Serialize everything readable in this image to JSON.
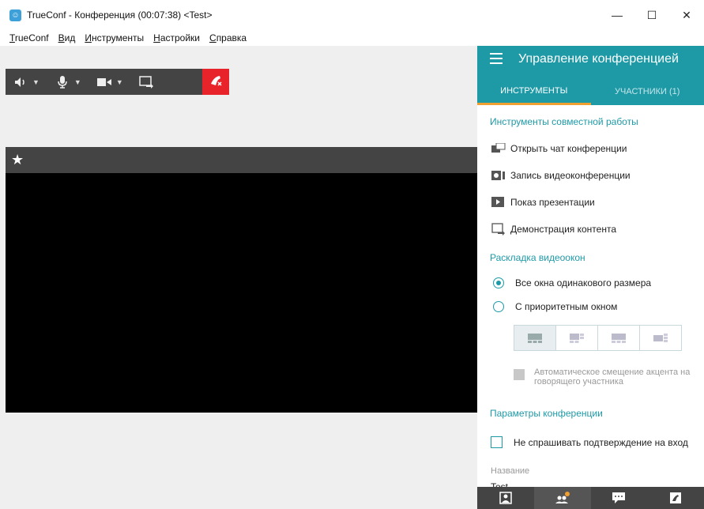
{
  "window": {
    "title": "TrueConf - Конференция (00:07:38) <Test>",
    "minimize_label": "—",
    "maximize_label": "☐",
    "close_label": "✕"
  },
  "menu": [
    "TrueConf",
    "Вид",
    "Инструменты",
    "Настройки",
    "Справка"
  ],
  "panel": {
    "title": "Управление конференцией",
    "tabs": [
      {
        "label": "ИНСТРУМЕНТЫ",
        "active": true
      },
      {
        "label": "УЧАСТНИКИ (1)",
        "active": false
      }
    ],
    "collab_section": "Инструменты совместной работы",
    "tools": [
      {
        "label": "Открыть чат конференции",
        "icon": "chat-icon"
      },
      {
        "label": "Запись видеоконференции",
        "icon": "record-icon"
      },
      {
        "label": "Показ презентации",
        "icon": "presentation-icon"
      },
      {
        "label": "Демонстрация контента",
        "icon": "screen-share-icon"
      }
    ],
    "layout_section": "Раскладка видеоокон",
    "layout_options": [
      {
        "label": "Все окна одинакового размера",
        "checked": true
      },
      {
        "label": "С приоритетным окном",
        "checked": false
      }
    ],
    "autoshift_label": "Автоматическое смещение акцента на говорящего участника",
    "params_section": "Параметры конференции",
    "no_confirm_label": "Не спрашивать подтверждение на вход",
    "name_label": "Название",
    "name_value": "Test"
  },
  "colors": {
    "accent": "#1e9aa7",
    "tab_underline": "#f0a030",
    "hangup": "#e8232a",
    "toolbar": "#444444"
  }
}
